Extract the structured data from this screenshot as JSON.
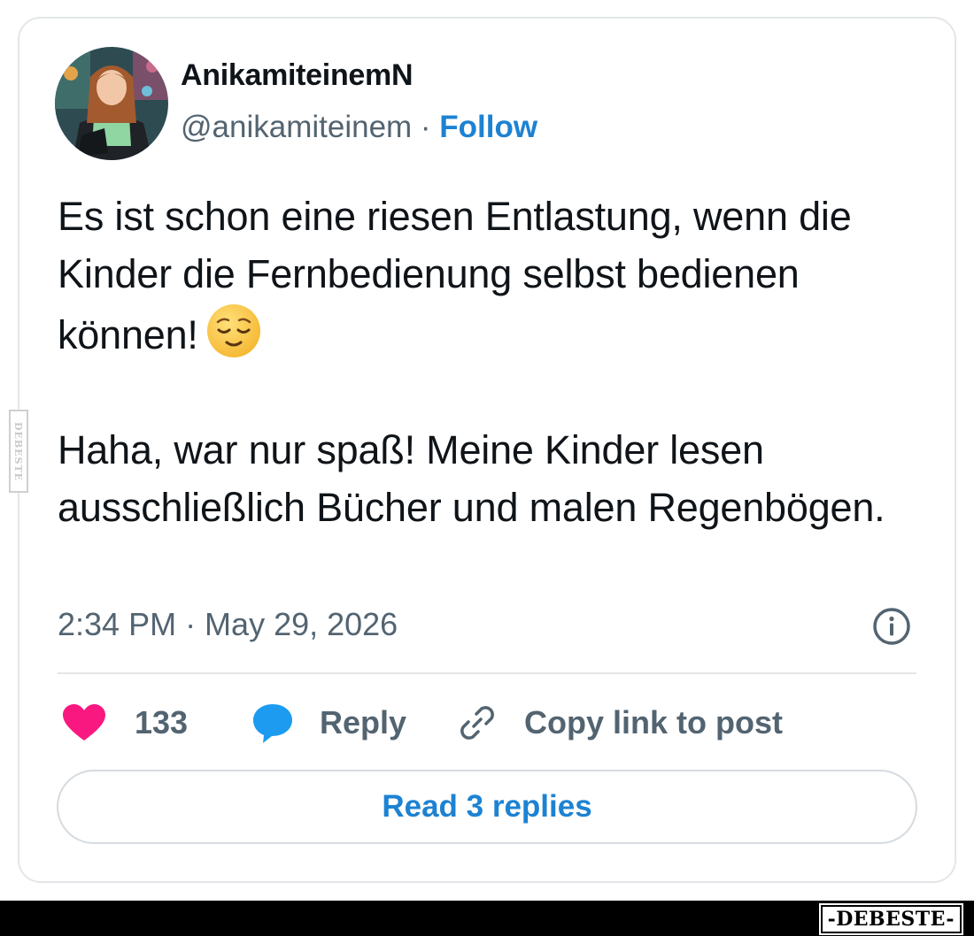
{
  "tweet": {
    "author": {
      "display_name": "AnikamiteinemN",
      "handle": "@anikamiteinem",
      "separator": " · ",
      "follow_label": "Follow"
    },
    "text_paragraphs": [
      "Es ist schon eine riesen Entlastung, wenn die Kinder die Fernbedienung selbst bedienen können!",
      "Haha, war nur spaß! Meine Kinder lesen ausschließlich Bücher und malen Regenbögen."
    ],
    "emoji": "relieved-face",
    "timestamp": "2:34 PM · May 29, 2026",
    "actions": {
      "like_count": "133",
      "reply_label": "Reply",
      "copy_link_label": "Copy link to post"
    },
    "read_replies_label": "Read 3 replies"
  },
  "watermark": {
    "side_text": "DEBESTE",
    "logo_text": "-DEBESTE-"
  },
  "colors": {
    "accent_blue": "#1d82d2",
    "heart_pink": "#f91880",
    "bubble_blue": "#1d9bf0",
    "muted_gray": "#536471",
    "border": "#e3e6e9"
  }
}
